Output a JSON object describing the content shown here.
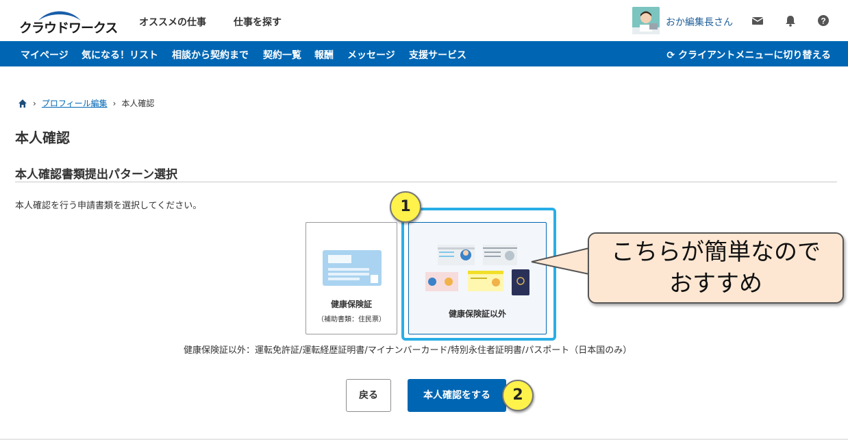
{
  "header": {
    "logo_text": "クラウドワークス",
    "nav": [
      "オススメの仕事",
      "仕事を探す"
    ],
    "user_name": "おか編集長さん",
    "icons": [
      "mail-icon",
      "bell-icon",
      "help-icon"
    ]
  },
  "navbar": {
    "items": [
      "マイページ",
      "気になる！リスト",
      "相談から契約まで",
      "契約一覧",
      "報酬",
      "メッセージ",
      "支援サービス"
    ],
    "switch_label": "クライアントメニューに切り替える"
  },
  "breadcrumb": {
    "link": "プロフィール編集",
    "current": "本人確認"
  },
  "page": {
    "title": "本人確認",
    "section_title": "本人確認書類提出パターン選択",
    "description": "本人確認を行う申請書類を選択してください。",
    "options": [
      {
        "label": "健康保険証",
        "sub": "（補助書類：住民票）"
      },
      {
        "label": "健康保険証以外"
      }
    ],
    "note": "健康保険証以外：運転免許証/運転経歴証明書/マイナンバーカード/特別永住者証明書/パスポート（日本国のみ）",
    "back_label": "戻る",
    "submit_label": "本人確認をする"
  },
  "annotations": {
    "badge1": "1",
    "badge2": "2",
    "callout_line1": "こちらが簡単なので",
    "callout_line2": "おすすめ"
  },
  "colors": {
    "brand_blue": "#0066b3",
    "highlight": "#29aee6",
    "badge": "#fff24a",
    "callout_bg": "#fde7d2"
  }
}
